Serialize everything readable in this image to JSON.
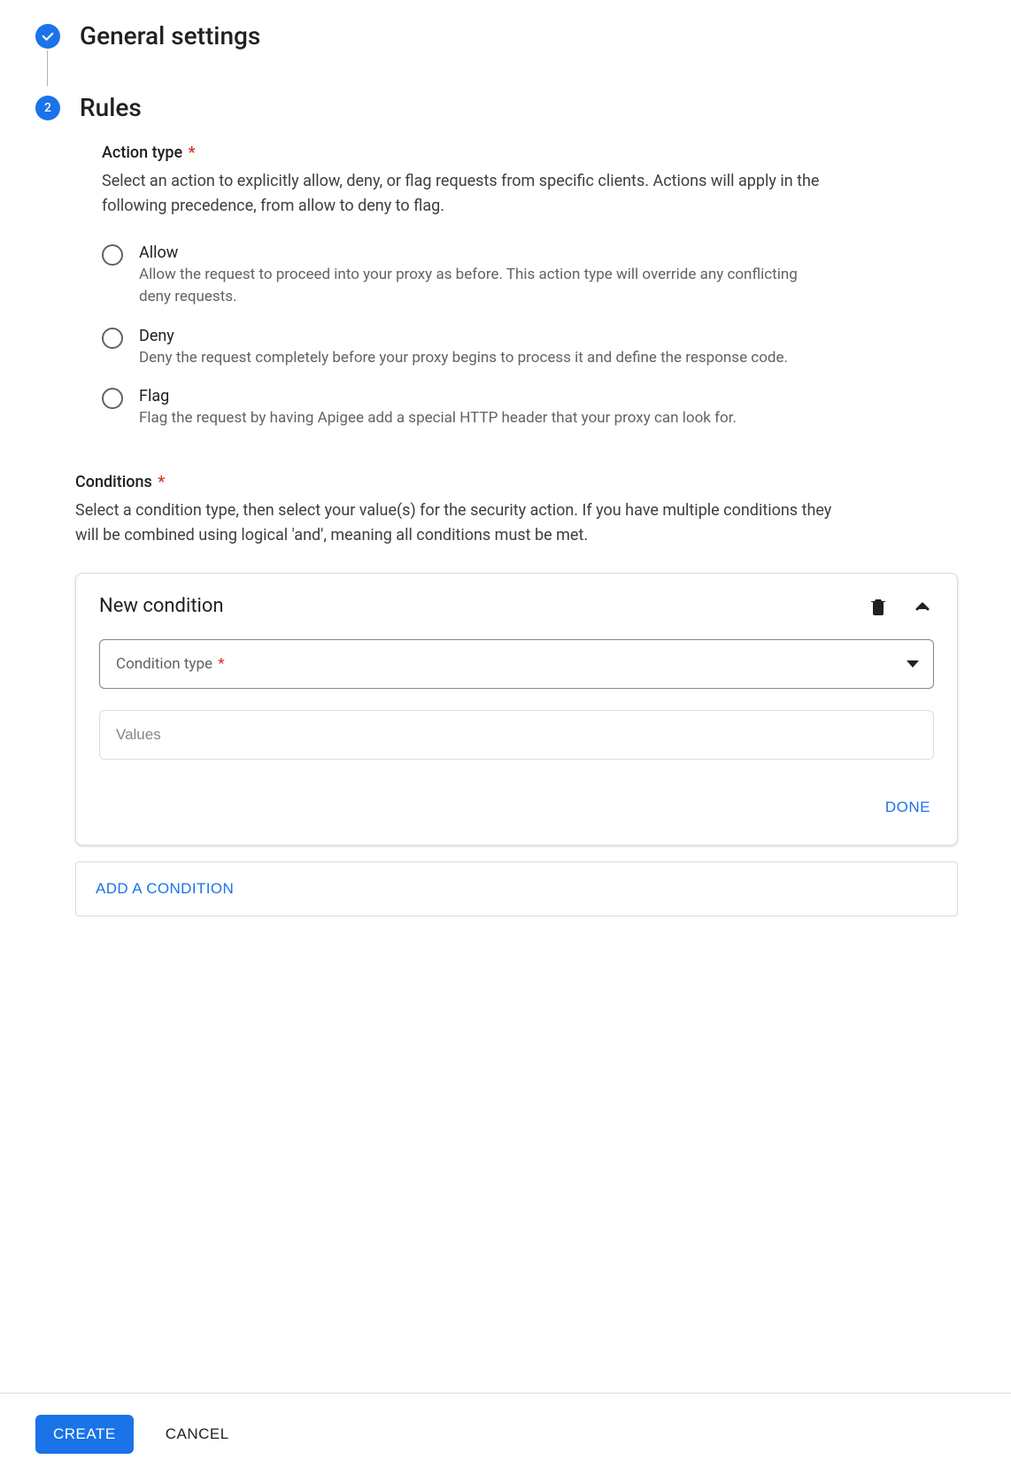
{
  "steps": {
    "one": {
      "title": "General settings"
    },
    "two": {
      "number": "2",
      "title": "Rules"
    }
  },
  "action_type": {
    "label": "Action type",
    "description": "Select an action to explicitly allow, deny, or flag requests from specific clients. Actions will apply in the following precedence, from allow to deny to flag.",
    "options": [
      {
        "title": "Allow",
        "desc": "Allow the request to proceed into your proxy as before. This action type will override any conflicting deny requests."
      },
      {
        "title": "Deny",
        "desc": "Deny the request completely before your proxy begins to process it and define the response code."
      },
      {
        "title": "Flag",
        "desc": "Flag the request by having Apigee add a special HTTP header that your proxy can look for."
      }
    ]
  },
  "conditions": {
    "label": "Conditions",
    "description": "Select a condition type, then select your value(s) for the security action. If you have multiple conditions they will be combined using logical 'and', meaning all conditions must be met.",
    "card": {
      "title": "New condition",
      "condition_type_label": "Condition type",
      "values_placeholder": "Values",
      "done_label": "DONE"
    },
    "add_button": "ADD A CONDITION"
  },
  "footer": {
    "create": "CREATE",
    "cancel": "CANCEL"
  },
  "required_marker": "*"
}
